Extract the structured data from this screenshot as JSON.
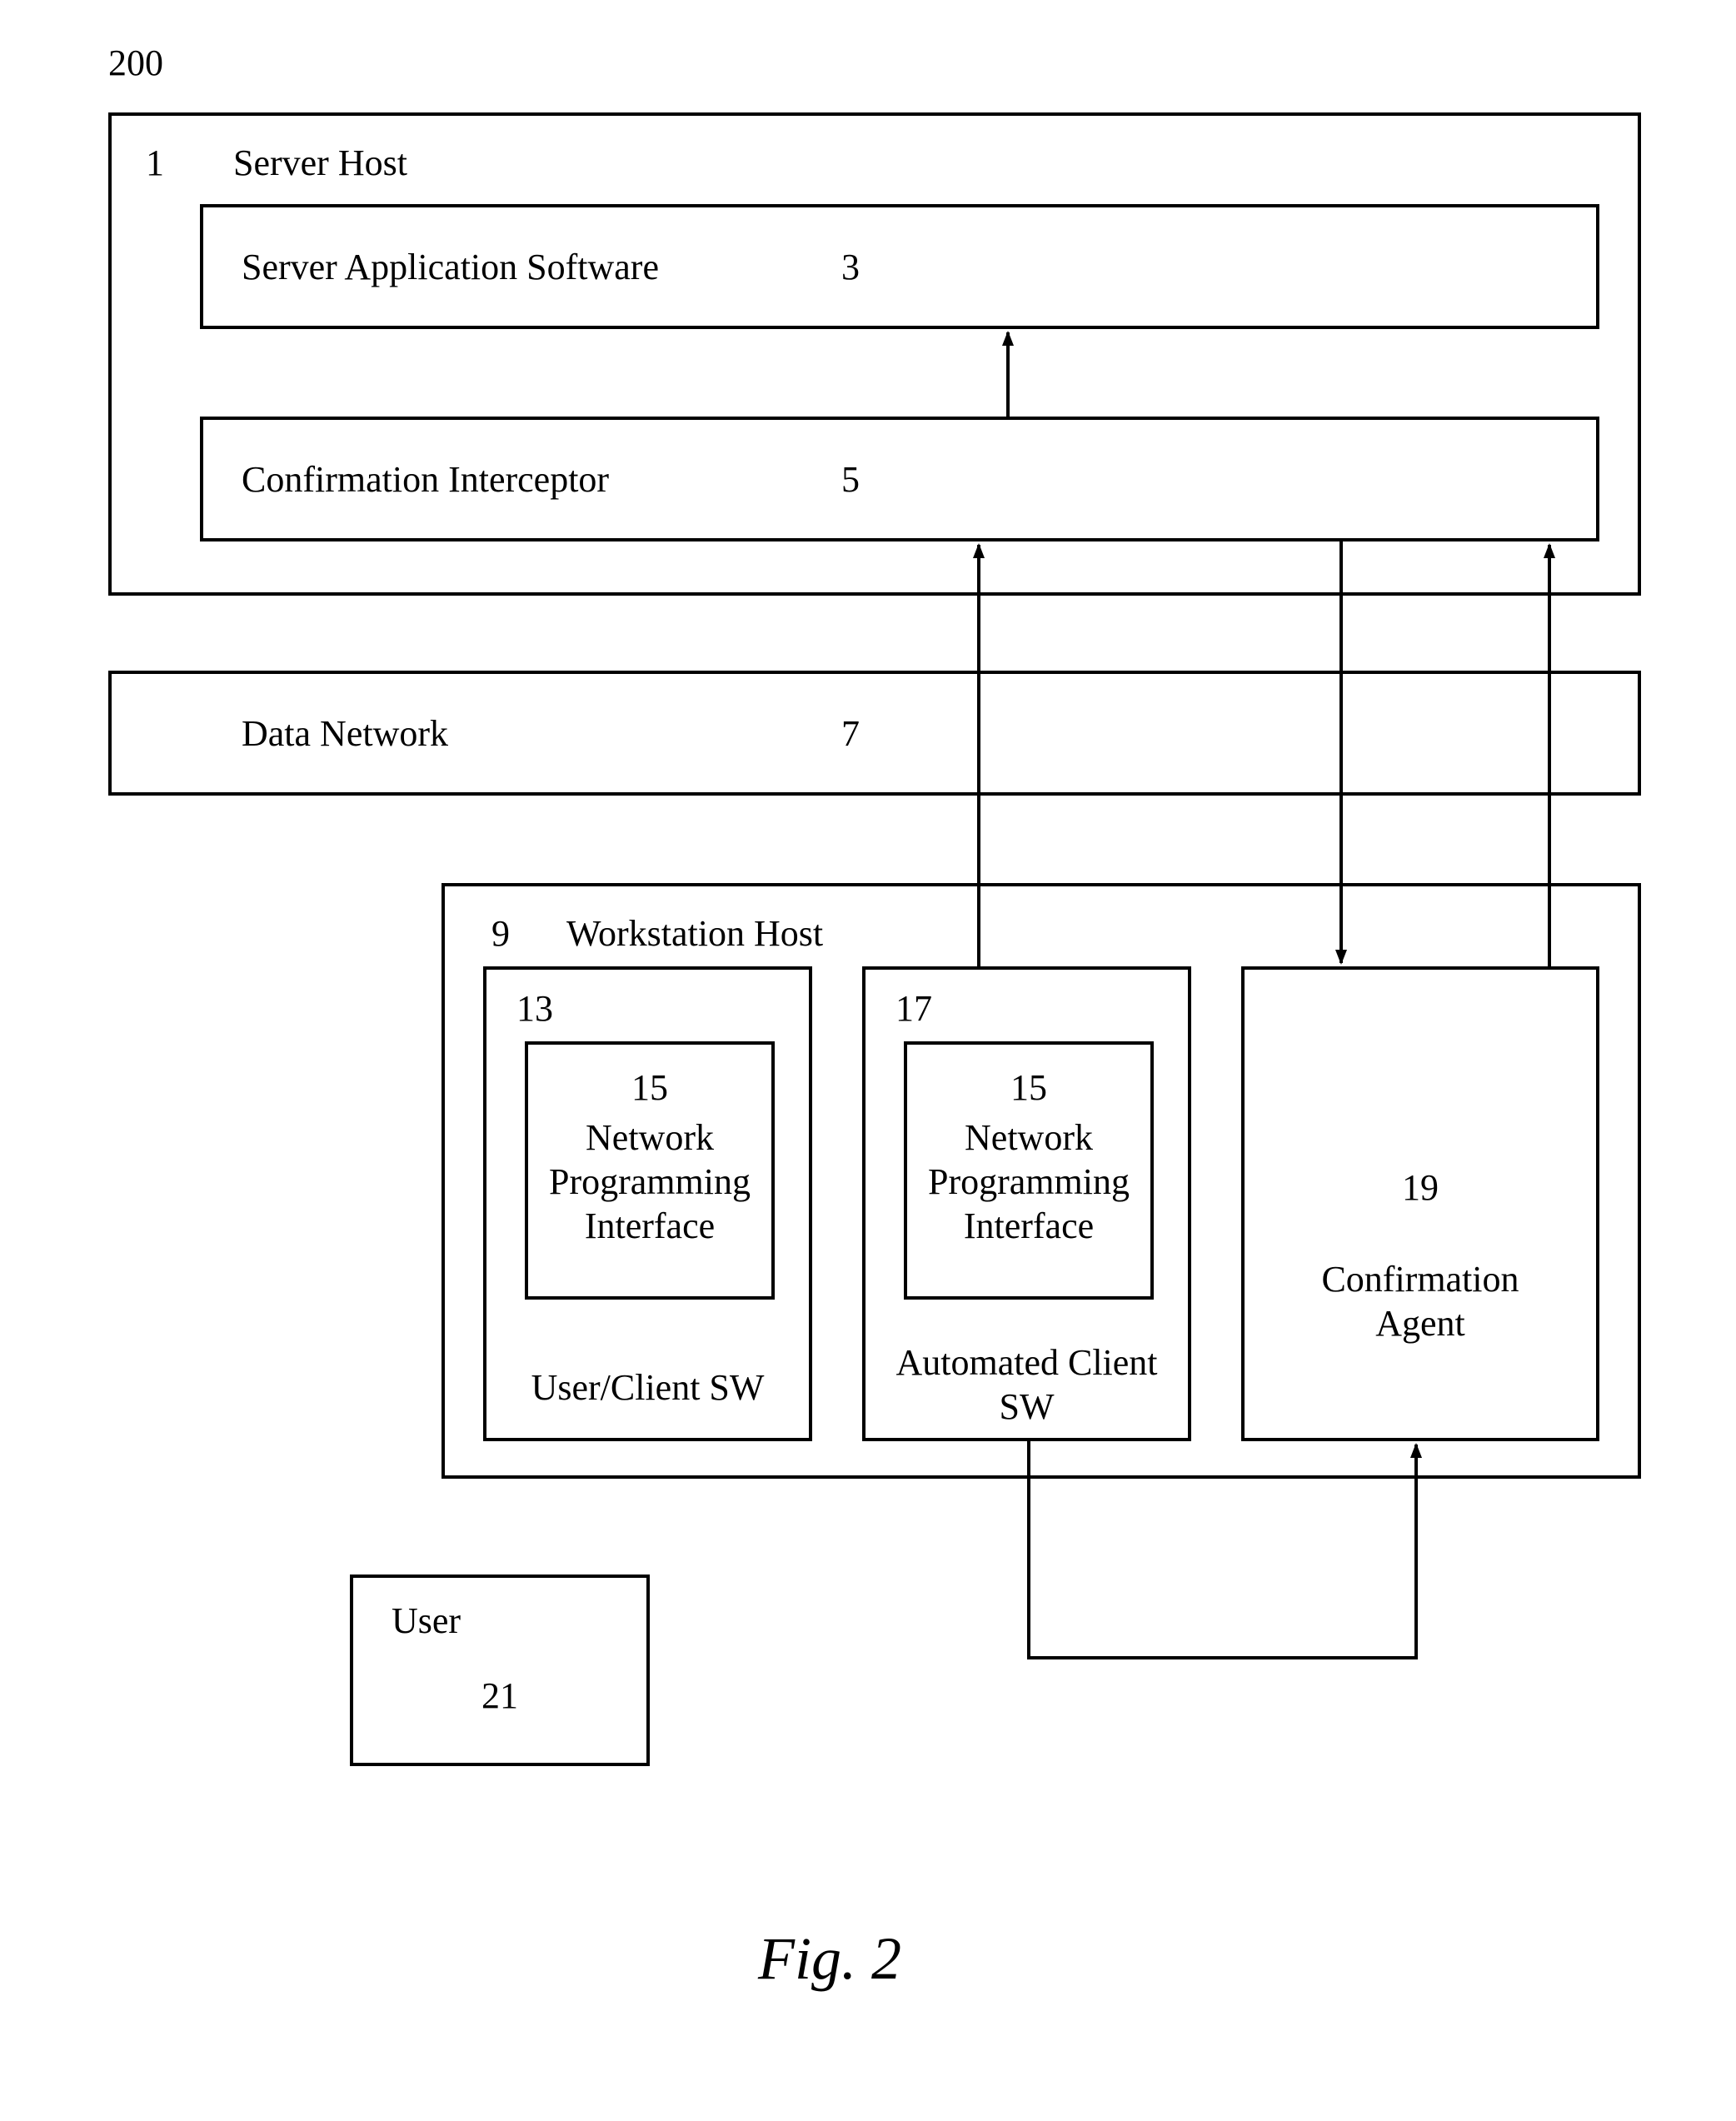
{
  "figure_number": "200",
  "figure_caption": "Fig. 2",
  "server_host": {
    "ref": "1",
    "title": "Server Host",
    "app": {
      "ref": "3",
      "label": "Server Application Software"
    },
    "interceptor": {
      "ref": "5",
      "label": "Confirmation Interceptor"
    }
  },
  "data_network": {
    "ref": "7",
    "label": "Data Network"
  },
  "workstation": {
    "ref": "9",
    "title": "Workstation Host",
    "user_client": {
      "ref": "13",
      "label": "User/Client SW",
      "npi": {
        "ref": "15",
        "label": "Network\nProgramming\nInterface"
      }
    },
    "auto_client": {
      "ref": "17",
      "label": "Automated Client\nSW",
      "npi": {
        "ref": "15",
        "label": "Network\nProgramming\nInterface"
      }
    },
    "confirmation_agent": {
      "ref": "19",
      "label": "Confirmation\nAgent"
    }
  },
  "user": {
    "ref": "21",
    "label": "User"
  }
}
